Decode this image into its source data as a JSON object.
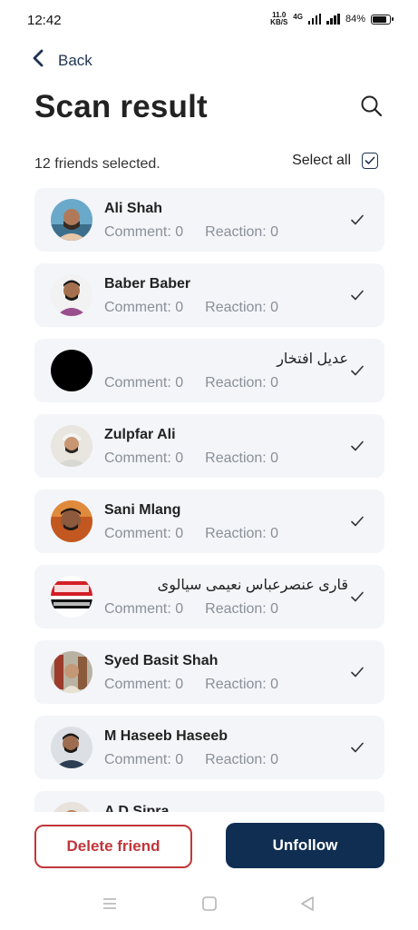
{
  "status_bar": {
    "time": "12:42",
    "net_speed_value": "11.0",
    "net_speed_unit": "KB/S",
    "network_type": "4G",
    "battery_percent": "84%",
    "battery_level": 0.84
  },
  "header": {
    "back_label": "Back",
    "title": "Scan result"
  },
  "selection": {
    "count_text": "12 friends selected.",
    "select_all_label": "Select all",
    "select_all_checked": true
  },
  "friends": [
    {
      "name": "Ali Shah",
      "comment": "Comment: 0",
      "reaction": "Reaction: 0",
      "rtl": false,
      "checked": true
    },
    {
      "name": "Baber Baber",
      "comment": "Comment: 0",
      "reaction": "Reaction: 0",
      "rtl": false,
      "checked": true
    },
    {
      "name": "عدیل افتخار",
      "comment": "Comment: 0",
      "reaction": "Reaction: 0",
      "rtl": true,
      "checked": true
    },
    {
      "name": "Zulpfar Ali",
      "comment": "Comment: 0",
      "reaction": "Reaction: 0",
      "rtl": false,
      "checked": true
    },
    {
      "name": "Sani Mlang",
      "comment": "Comment: 0",
      "reaction": "Reaction: 0",
      "rtl": false,
      "checked": true
    },
    {
      "name": "قاری عنصرعباس نعیمی سیالوی",
      "comment": "Comment: 0",
      "reaction": "Reaction: 0",
      "rtl": true,
      "checked": true
    },
    {
      "name": "Syed Basit Shah",
      "comment": "Comment: 0",
      "reaction": "Reaction: 0",
      "rtl": false,
      "checked": true
    },
    {
      "name": "M Haseeb Haseeb",
      "comment": "Comment: 0",
      "reaction": "Reaction: 0",
      "rtl": false,
      "checked": true
    },
    {
      "name": "A D Sipra",
      "comment": "",
      "reaction": "",
      "rtl": false,
      "checked": true
    }
  ],
  "actions": {
    "delete_label": "Delete friend",
    "unfollow_label": "Unfollow"
  },
  "colors": {
    "accent_navy": "#0f2e52",
    "danger_red": "#c0363a",
    "card_bg": "#f3f5f9",
    "muted_text": "#8a8f98"
  },
  "icons": {
    "back": "chevron-left-icon",
    "search": "search-icon",
    "select_all": "checkbox-checked-icon",
    "row_check": "checkmark-icon",
    "nav_menu": "menu-icon",
    "nav_home": "home-square-icon",
    "nav_back": "back-triangle-icon"
  }
}
